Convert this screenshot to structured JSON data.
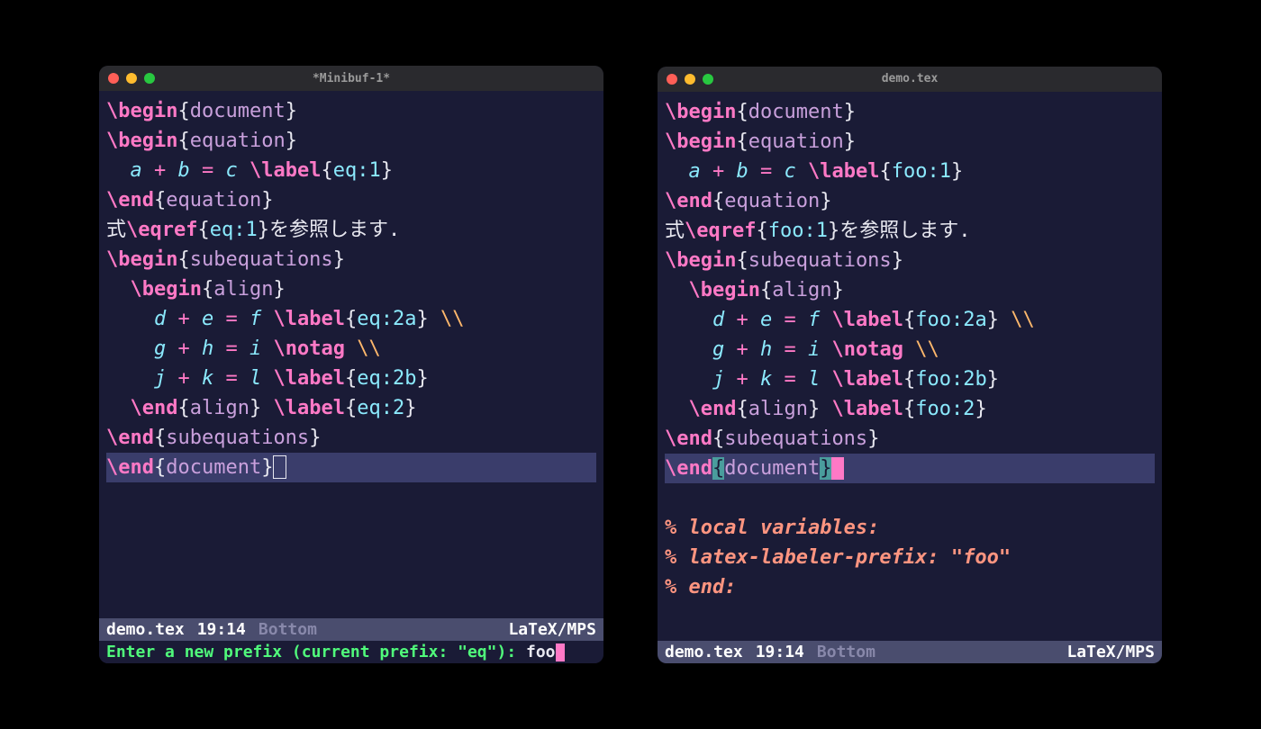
{
  "left": {
    "title": "*Minibuf-1*",
    "code": {
      "l1": {
        "cmd": "\\begin",
        "env": "document"
      },
      "l2": {
        "cmd": "\\begin",
        "env": "equation"
      },
      "l3": {
        "a": "a",
        "plus": "+",
        "b": "b",
        "eq": "=",
        "c": "c",
        "cmd": "\\label",
        "arg": "eq:1"
      },
      "l4": {
        "cmd": "\\end",
        "env": "equation"
      },
      "l5": {
        "pre": "式",
        "cmd": "\\eqref",
        "arg": "eq:1",
        "post": "を参照します."
      },
      "l6": {
        "cmd": "\\begin",
        "env": "subequations"
      },
      "l7": {
        "cmd": "\\begin",
        "env": "align"
      },
      "l8": {
        "a": "d",
        "plus": "+",
        "b": "e",
        "eq": "=",
        "c": "f",
        "cmd": "\\label",
        "arg": "eq:2a",
        "cont": "\\\\"
      },
      "l9": {
        "a": "g",
        "plus": "+",
        "b": "h",
        "eq": "=",
        "c": "i",
        "cmd": "\\notag",
        "cont": "\\\\"
      },
      "l10": {
        "a": "j",
        "plus": "+",
        "b": "k",
        "eq": "=",
        "c": "l",
        "cmd": "\\label",
        "arg": "eq:2b"
      },
      "l11": {
        "cmd": "\\end",
        "env": "align",
        "cmd2": "\\label",
        "arg": "eq:2"
      },
      "l12": {
        "cmd": "\\end",
        "env": "subequations"
      },
      "l13": {
        "cmd": "\\end",
        "env": "document"
      }
    },
    "modeline": {
      "file": "demo.tex",
      "pos": "19:14",
      "loc": "Bottom",
      "mode": "LaTeX/MPS"
    },
    "minibuf": {
      "prompt": "Enter a new prefix (current prefix: \"eq\"): ",
      "input": "foo"
    }
  },
  "right": {
    "title": "demo.tex",
    "code": {
      "l1": {
        "cmd": "\\begin",
        "env": "document"
      },
      "l2": {
        "cmd": "\\begin",
        "env": "equation"
      },
      "l3": {
        "a": "a",
        "plus": "+",
        "b": "b",
        "eq": "=",
        "c": "c",
        "cmd": "\\label",
        "arg": "foo:1"
      },
      "l4": {
        "cmd": "\\end",
        "env": "equation"
      },
      "l5": {
        "pre": "式",
        "cmd": "\\eqref",
        "arg": "foo:1",
        "post": "を参照します."
      },
      "l6": {
        "cmd": "\\begin",
        "env": "subequations"
      },
      "l7": {
        "cmd": "\\begin",
        "env": "align"
      },
      "l8": {
        "a": "d",
        "plus": "+",
        "b": "e",
        "eq": "=",
        "c": "f",
        "cmd": "\\label",
        "arg": "foo:2a",
        "cont": "\\\\"
      },
      "l9": {
        "a": "g",
        "plus": "+",
        "b": "h",
        "eq": "=",
        "c": "i",
        "cmd": "\\notag",
        "cont": "\\\\"
      },
      "l10": {
        "a": "j",
        "plus": "+",
        "b": "k",
        "eq": "=",
        "c": "l",
        "cmd": "\\label",
        "arg": "foo:2b"
      },
      "l11": {
        "cmd": "\\end",
        "env": "align",
        "cmd2": "\\label",
        "arg": "foo:2"
      },
      "l12": {
        "cmd": "\\end",
        "env": "subequations"
      },
      "l13": {
        "cmd": "\\end",
        "env": "document"
      },
      "c1": "% local variables:",
      "c2": "% latex-labeler-prefix: \"foo\"",
      "c3": "% end:"
    },
    "modeline": {
      "file": "demo.tex",
      "pos": "19:14",
      "loc": "Bottom",
      "mode": "LaTeX/MPS"
    }
  }
}
